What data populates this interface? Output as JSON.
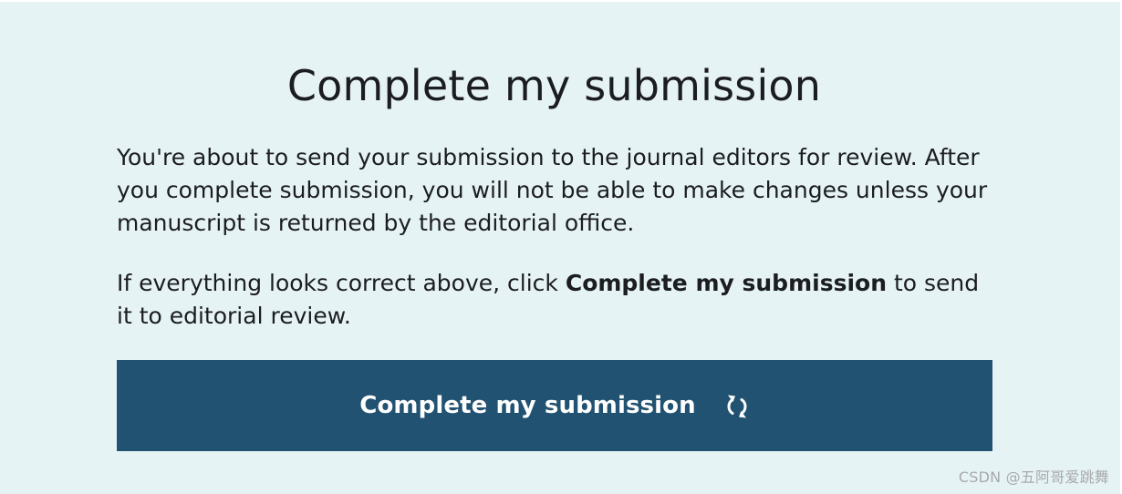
{
  "dialog": {
    "title": "Complete my submission",
    "paragraph1": "You're about to send your submission to the journal editors for review. After you complete submission, you will not be able to make changes unless your manuscript is returned by the editorial office.",
    "paragraph2_prefix": "If everything looks correct above, click ",
    "paragraph2_bold": "Complete my submission",
    "paragraph2_suffix": " to send it to editorial review.",
    "button_label": "Complete my submission",
    "button_icon": "refresh-icon"
  },
  "watermark": "CSDN @五阿哥爱跳舞",
  "colors": {
    "background": "#e6f3f5",
    "button": "#225271",
    "text": "#1b1d20",
    "button_text": "#ffffff"
  }
}
